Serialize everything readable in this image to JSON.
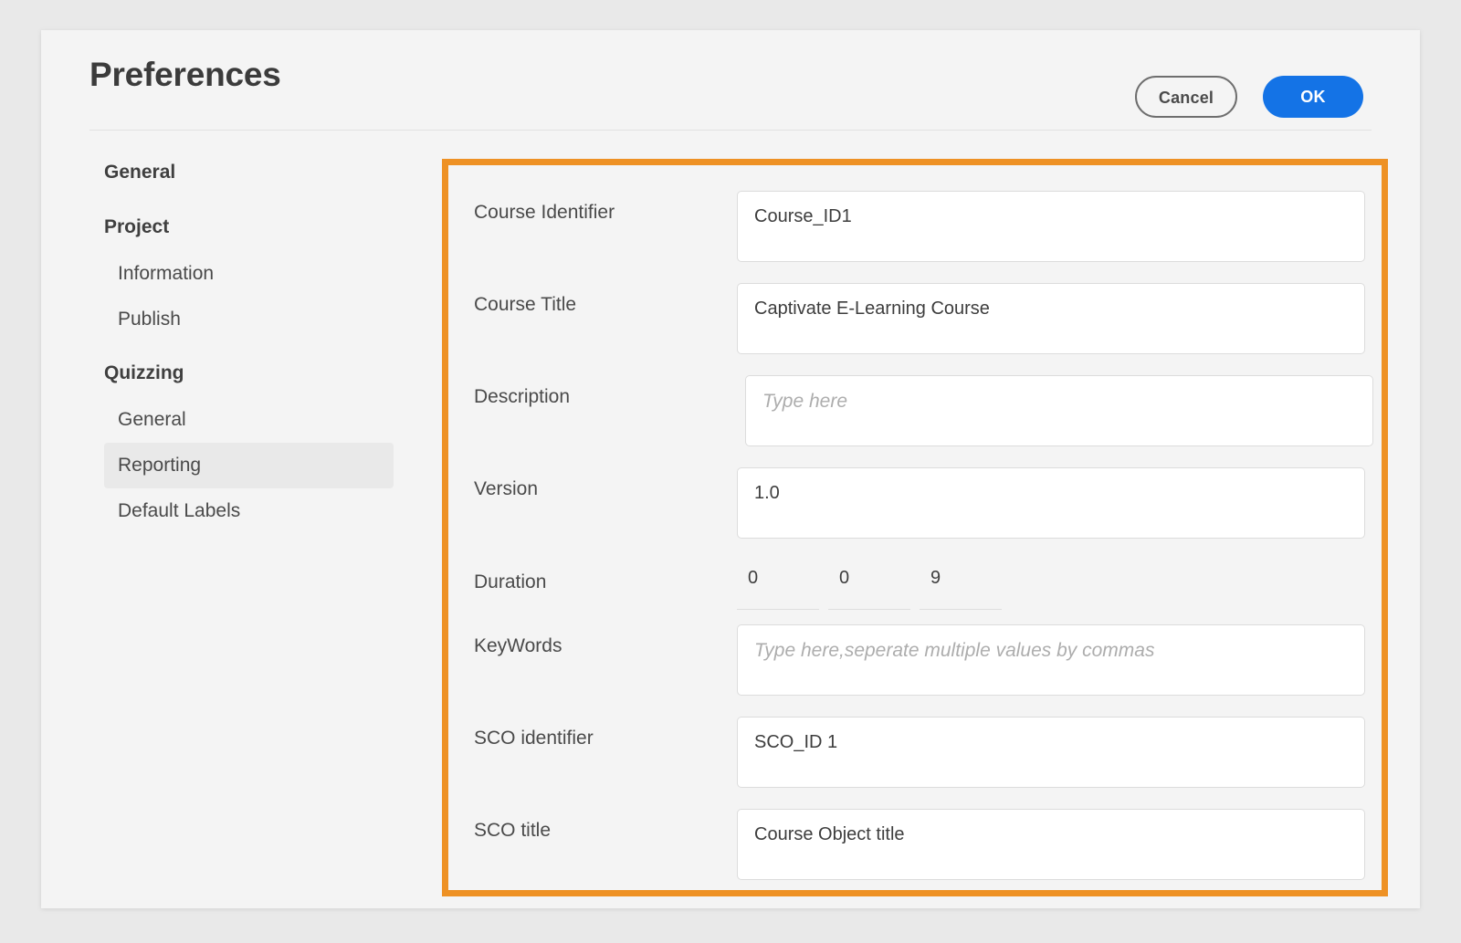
{
  "header": {
    "title": "Preferences",
    "cancel_label": "Cancel",
    "ok_label": "OK"
  },
  "colors": {
    "accent_blue": "#1473E6",
    "highlight_orange": "#EE9124",
    "selected_row": "#E9E9E9",
    "dialog_bg": "#F4F4F4",
    "page_bg": "#E9E9E9"
  },
  "sidebar": {
    "items": [
      {
        "label": "General",
        "type": "group",
        "selected": false
      },
      {
        "label": "Project",
        "type": "group",
        "selected": false
      },
      {
        "label": "Information",
        "type": "item",
        "selected": false
      },
      {
        "label": "Publish",
        "type": "item",
        "selected": false
      },
      {
        "label": "Quizzing",
        "type": "group",
        "selected": false
      },
      {
        "label": "General",
        "type": "item",
        "selected": false
      },
      {
        "label": "Reporting",
        "type": "item",
        "selected": true
      },
      {
        "label": "Default Labels",
        "type": "item",
        "selected": false
      }
    ]
  },
  "form": {
    "fields": [
      {
        "label": "Course Identifier",
        "value": "Course_ID1",
        "placeholder": ""
      },
      {
        "label": "Course Title",
        "value": "Captivate E-Learning Course",
        "placeholder": ""
      },
      {
        "label": "Description",
        "value": "",
        "placeholder": "Type here"
      },
      {
        "label": "Version",
        "value": "1.0",
        "placeholder": ""
      },
      {
        "label": "KeyWords",
        "value": "",
        "placeholder": "Type here,seperate multiple values by commas"
      },
      {
        "label": "SCO identifier",
        "value": "SCO_ID 1",
        "placeholder": ""
      },
      {
        "label": "SCO title",
        "value": "Course Object title",
        "placeholder": ""
      }
    ],
    "duration": {
      "label": "Duration",
      "values": [
        "0",
        "0",
        "9"
      ]
    }
  }
}
